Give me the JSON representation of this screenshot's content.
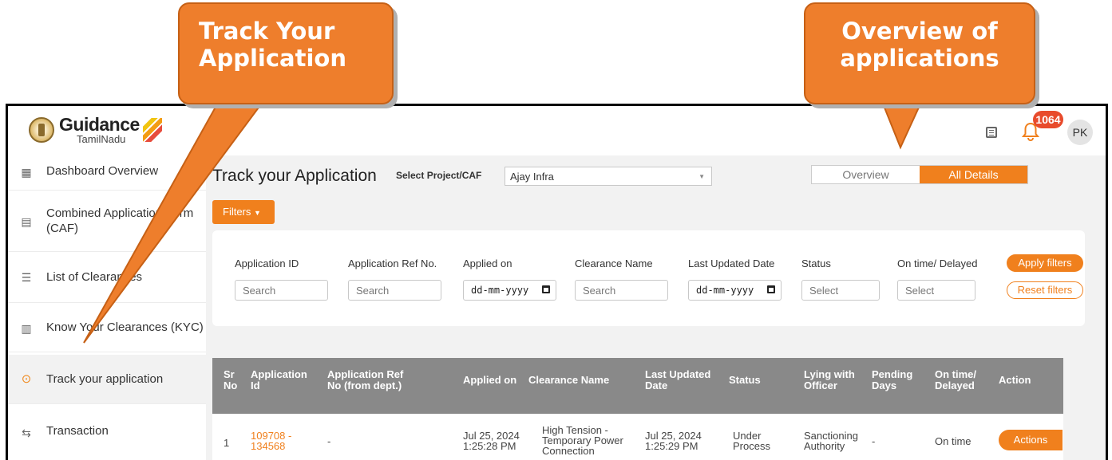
{
  "annotations": {
    "left_callout": [
      "Track Your",
      "Application"
    ],
    "right_callout": [
      "Overview of",
      "applications"
    ]
  },
  "header": {
    "brand_name": "Guidance",
    "brand_sub": "TamilNadu",
    "notification_count": "1064",
    "avatar_initials": "PK",
    "accent_color": "#f0801d"
  },
  "sidebar": {
    "items": [
      {
        "label": "Dashboard Overview",
        "icon": "dashboard-icon"
      },
      {
        "label": "Combined Application Form (CAF)",
        "icon": "document-icon"
      },
      {
        "label": "List of Clearances",
        "icon": "list-icon"
      },
      {
        "label": "Know Your Clearances (KYC)",
        "icon": "book-icon"
      },
      {
        "label": "Track your application",
        "icon": "location-pin-icon",
        "active": true
      },
      {
        "label": "Transaction",
        "icon": "transaction-icon"
      }
    ]
  },
  "main": {
    "title": "Track your Application",
    "select_label": "Select Project/CAF",
    "select_value": "Ajay Infra",
    "toggle": {
      "overview": "Overview",
      "all_details": "All Details",
      "selected": "All Details"
    },
    "filters_button": "Filters",
    "filter_fields": [
      {
        "label": "Application ID",
        "placeholder": "Search"
      },
      {
        "label": "Application Ref No.",
        "placeholder": "Search"
      },
      {
        "label": "Applied on",
        "placeholder": "dd-mm-yyyy"
      },
      {
        "label": "Clearance Name",
        "placeholder": "Search"
      },
      {
        "label": "Last Updated Date",
        "placeholder": "dd-mm-yyyy"
      },
      {
        "label": "Status",
        "placeholder": "Select"
      },
      {
        "label": "On time/ Delayed",
        "placeholder": "Select"
      }
    ],
    "apply_filters": "Apply filters",
    "reset_filters": "Reset filters"
  },
  "table": {
    "headers": [
      [
        "Sr",
        "No"
      ],
      [
        "Application",
        "Id"
      ],
      [
        "Application Ref",
        "No (from dept.)"
      ],
      [
        "Applied on",
        ""
      ],
      [
        "Clearance Name",
        ""
      ],
      [
        "Last Updated",
        "Date"
      ],
      [
        "Status",
        ""
      ],
      [
        "Lying with",
        "Officer"
      ],
      [
        "Pending",
        "Days"
      ],
      [
        "On time/",
        "Delayed"
      ],
      [
        "Action",
        ""
      ]
    ],
    "rows": [
      {
        "sr_no": "1",
        "application_id": [
          "109708 -",
          "134568"
        ],
        "ref_no": "-",
        "applied_on": [
          "Jul 25, 2024",
          "1:25:28 PM"
        ],
        "clearance_name": [
          "High Tension -",
          "Temporary Power",
          "Connection"
        ],
        "last_updated": [
          "Jul 25, 2024",
          "1:25:29 PM"
        ],
        "status": [
          "Under",
          "Process"
        ],
        "lying_with": [
          "Sanctioning",
          "Authority"
        ],
        "pending_days": "-",
        "on_time": "On time",
        "action": "Actions"
      }
    ]
  }
}
